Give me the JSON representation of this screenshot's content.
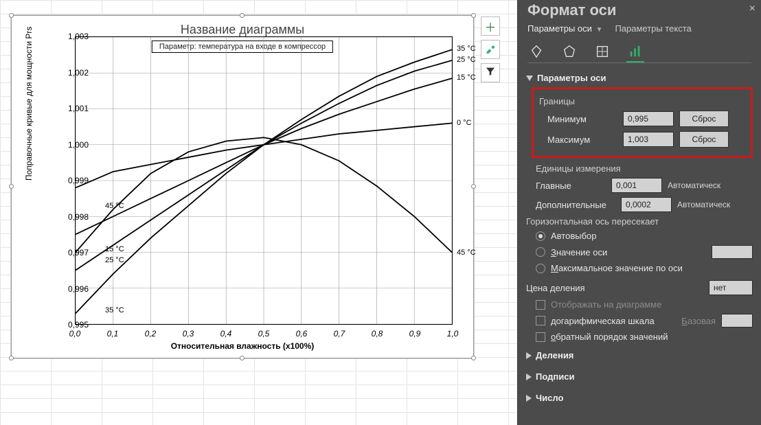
{
  "pane": {
    "title": "Формат оси",
    "tab_axis_options": "Параметры оси",
    "tab_text_options": "Параметры текста",
    "section_axis_options_hdr": "Параметры оси",
    "bounds_hdr": "Границы",
    "min_label": "Минимум",
    "min_value": "0,995",
    "min_btn": "Сброс",
    "max_label": "Максимум",
    "max_value": "1,003",
    "max_btn": "Сброс",
    "units_hdr": "Единицы измерения",
    "major_label": "Главные",
    "major_value": "0,001",
    "major_auto": "Автоматическ",
    "minor_label": "Дополнительные",
    "minor_value": "0,0002",
    "minor_auto": "Автоматическ",
    "hcross_hdr": "Горизонтальная ось пересекает",
    "hcross_auto": "Автовыбор",
    "hcross_atvalue": "Значение оси",
    "hcross_atmax": "Максимальное значение по оси",
    "display_units_label": "Цена деления",
    "display_units_value": "нет",
    "show_on_chart": "Отображать на диаграмме",
    "log_scale": "догарифмическая шкала",
    "log_base_label": "Базовая",
    "rev_order": "обратный порядок значений",
    "section_ticks_hdr": "Деления",
    "section_labels_hdr": "Подписи",
    "section_number_hdr": "Число"
  },
  "chart_ui": {
    "title": "Название диаграммы",
    "param_box": "Параметр: температура на входе в компрессор"
  },
  "chart_data": {
    "type": "line",
    "title": "Название диаграммы",
    "subtitle": "Параметр: температура на входе в компрессор",
    "xlabel": "Относительная влажность (x100%)",
    "ylabel": "Поправочные кривые для мощности Prs",
    "xlim": [
      0.0,
      1.0
    ],
    "ylim": [
      0.995,
      1.003
    ],
    "xticks": [
      0.0,
      0.1,
      0.2,
      0.3,
      0.4,
      0.5,
      0.6,
      0.7,
      0.8,
      0.9,
      1.0
    ],
    "xtick_labels": [
      "0,0",
      "0,1",
      "0,2",
      "0,3",
      "0,4",
      "0,5",
      "0,6",
      "0,7",
      "0,8",
      "0,9",
      "1,0"
    ],
    "yticks": [
      0.995,
      0.996,
      0.997,
      0.998,
      0.999,
      1.0,
      1.001,
      1.002,
      1.003
    ],
    "ytick_labels": [
      "0,995",
      "0,996",
      "0,997",
      "0,998",
      "0,999",
      "1,000",
      "1,001",
      "1,002",
      "1,003"
    ],
    "series": [
      {
        "name": "0 °C",
        "x": [
          0.0,
          0.1,
          0.2,
          0.3,
          0.4,
          0.5,
          0.6,
          0.7,
          0.8,
          0.9,
          1.0
        ],
        "y": [
          0.9988,
          0.99925,
          0.99945,
          0.99965,
          0.99985,
          1.0,
          1.00015,
          1.0003,
          1.0004,
          1.0005,
          1.0006
        ]
      },
      {
        "name": "15 °C",
        "x": [
          0.0,
          0.1,
          0.2,
          0.3,
          0.4,
          0.5,
          0.6,
          0.7,
          0.8,
          0.9,
          1.0
        ],
        "y": [
          0.9975,
          0.998,
          0.9985,
          0.999,
          0.9995,
          1.0,
          1.00045,
          1.00085,
          1.0012,
          1.00155,
          1.00185
        ]
      },
      {
        "name": "25 °C",
        "x": [
          0.0,
          0.1,
          0.2,
          0.3,
          0.4,
          0.5,
          0.6,
          0.7,
          0.8,
          0.9,
          1.0
        ],
        "y": [
          0.9965,
          0.9972,
          0.9979,
          0.9986,
          0.9993,
          1.0,
          1.0006,
          1.00115,
          1.00165,
          1.00205,
          1.00235
        ]
      },
      {
        "name": "35 °C",
        "x": [
          0.0,
          0.1,
          0.2,
          0.3,
          0.4,
          0.5,
          0.6,
          0.7,
          0.8,
          0.9,
          1.0
        ],
        "y": [
          0.9953,
          0.9964,
          0.9974,
          0.9983,
          0.9992,
          1.0,
          1.0007,
          1.00135,
          1.0019,
          1.0023,
          1.00265
        ]
      },
      {
        "name": "45 °C",
        "x": [
          0.0,
          0.1,
          0.2,
          0.3,
          0.4,
          0.5,
          0.6,
          0.7,
          0.8,
          0.9,
          1.0
        ],
        "y": [
          0.997,
          0.9982,
          0.9992,
          0.9998,
          1.0001,
          1.0002,
          1.0,
          0.99955,
          0.99885,
          0.998,
          0.997
        ]
      }
    ],
    "right_end_labels": [
      "25 °C",
      "35 °C",
      "15 °C",
      "0 °C",
      "45 °C"
    ],
    "left_mid_labels": [
      {
        "text": "45 °C",
        "y": 0.9983
      },
      {
        "text": "15 °C",
        "y": 0.9971
      },
      {
        "text": "25 °C",
        "y": 0.9968
      },
      {
        "text": "35 °C",
        "y": 0.9954
      }
    ]
  }
}
